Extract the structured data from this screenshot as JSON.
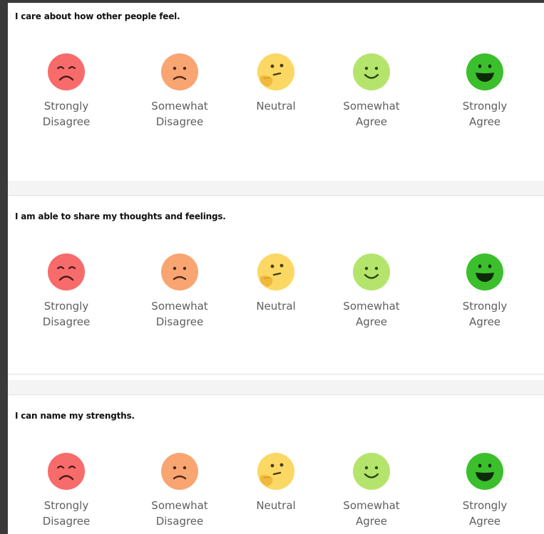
{
  "questions": [
    {
      "text": "I care about how other people feel."
    },
    {
      "text": "I am able to share my thoughts and feelings."
    },
    {
      "text": "I can name my strengths."
    }
  ],
  "scale": [
    {
      "label": "Strongly\nDisagree",
      "icon": "very-sad-face-icon",
      "color": "#f76b6b"
    },
    {
      "label": "Somewhat\nDisagree",
      "icon": "sad-face-icon",
      "color": "#f8a572"
    },
    {
      "label": "Neutral",
      "icon": "thinking-face-icon",
      "color": "#fbd863"
    },
    {
      "label": "Somewhat\nAgree",
      "icon": "smile-face-icon",
      "color": "#b5e46c"
    },
    {
      "label": "Strongly\nAgree",
      "icon": "big-smile-face-icon",
      "color": "#3cbf2c"
    }
  ]
}
